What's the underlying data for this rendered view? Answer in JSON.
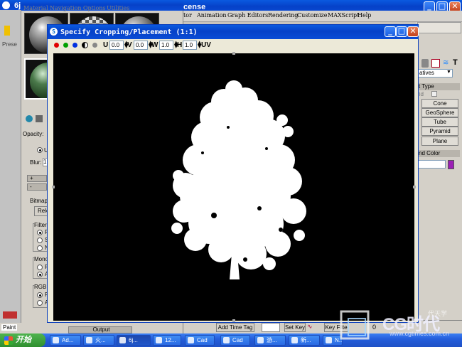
{
  "max_window": {
    "title": "cense",
    "menu": [
      "tor",
      "Animation",
      "Graph Editors",
      "Rendering",
      "Customize",
      "MAXScript",
      "Help"
    ]
  },
  "material_editor": {
    "title": "6j",
    "menu": [
      "Material",
      "Navigation",
      "Options",
      "Utilities"
    ],
    "side_label": "Prese",
    "opacity_label": "Opacity:",
    "uv_label": "UV",
    "blur_label": "Blur:",
    "blur_value": "1.",
    "bitmap_label": "Bitmap:",
    "reload_label": "Reload",
    "filtering_label": "Filtering",
    "filtering_opts": [
      "P",
      "S",
      "N"
    ],
    "mono_label": "Mono",
    "mono_opts": [
      "R",
      "A"
    ],
    "rgb_label": "RGB O",
    "rgb_opts": [
      "R",
      "A"
    ],
    "rollout_plus": "+",
    "rollout_minus": "-",
    "output_label": "Output",
    "paint_label": "Paint"
  },
  "command_panel": {
    "dropdown": "atives",
    "section_object_type": "t Type",
    "grid_label": "rid",
    "buttons": [
      "Cone",
      "GeoSphere",
      "Tube",
      "Pyramid",
      "Plane"
    ],
    "section_name_color": "nd Color",
    "color_swatch": "#9b1fb5"
  },
  "bottom_bar": {
    "add_time_tag": "Add Time Tag",
    "set_key": "Set Key",
    "key_filters": "Key Filte",
    "frame": "0"
  },
  "dialog": {
    "title": "Specify Cropping/Placement (1:1)",
    "u_label": "U",
    "u_value": "0.0",
    "v_label": "V",
    "v_value": "0.0",
    "w_label": "W",
    "w_value": "1.0",
    "h_label": "H",
    "h_value": "1.0",
    "uv_label": "UV",
    "channel_colors": [
      "#e00000",
      "#00a000",
      "#0030e0"
    ]
  },
  "taskbar": {
    "start_label": "开始",
    "tasks": [
      {
        "label": "Ad..."
      },
      {
        "label": "火..."
      },
      {
        "label": "6j..."
      },
      {
        "label": "12..."
      },
      {
        "label": "Cad"
      },
      {
        "label": "Cad"
      },
      {
        "label": "游..."
      },
      {
        "label": "新..."
      },
      {
        "label": "N..."
      }
    ]
  },
  "watermark": {
    "brand": "CG时代",
    "sub": "www.cgtimes.com.cn",
    "tag": "代天学"
  }
}
